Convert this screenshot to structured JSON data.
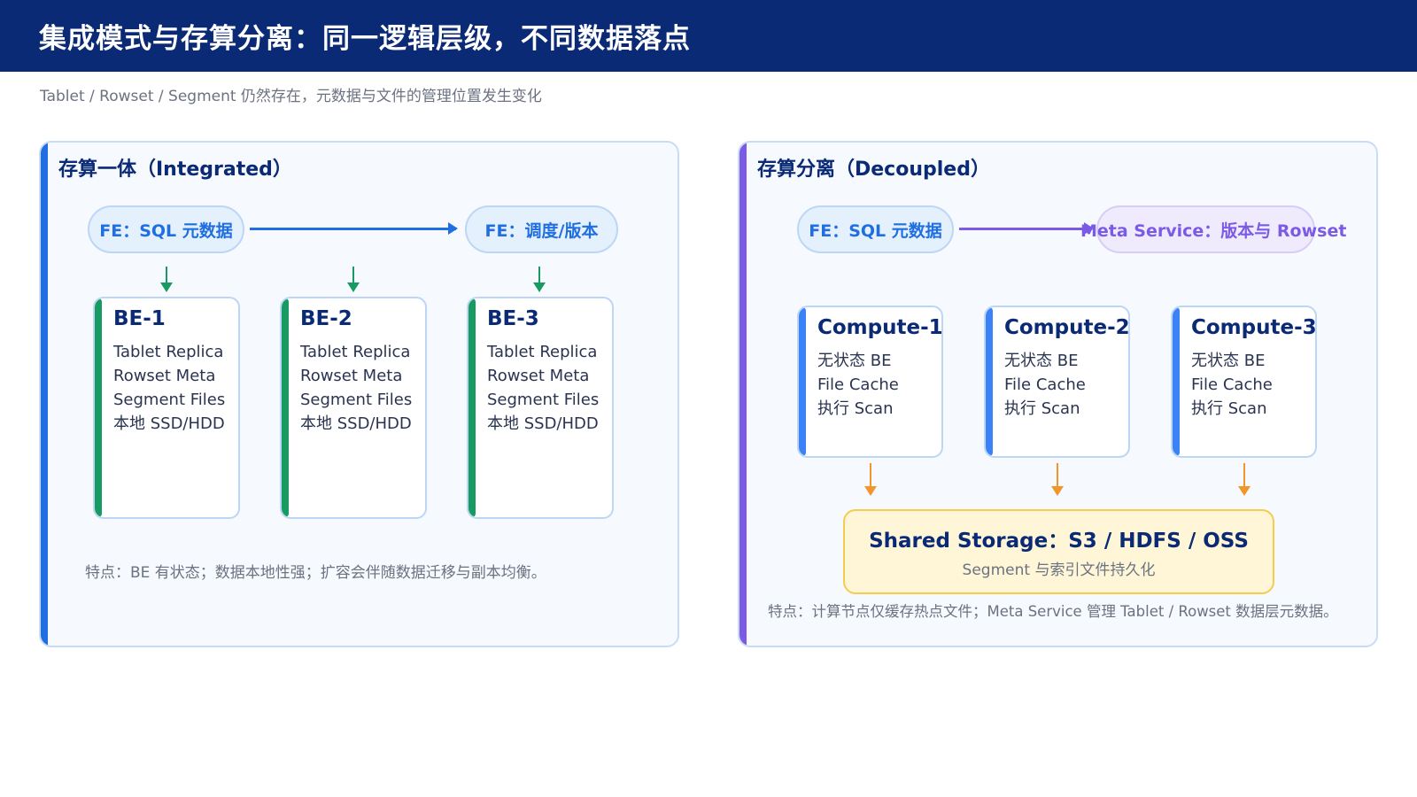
{
  "header": {
    "title": "集成模式与存算分离：同一逻辑层级，不同数据落点"
  },
  "subtitle": "Tablet / Rowset / Segment 仍然存在，元数据与文件的管理位置发生变化",
  "integrated": {
    "title": "存算一体（Integrated）",
    "fe_sql": "FE：SQL 元数据",
    "fe_schedule": "FE：调度/版本",
    "nodes": [
      {
        "name": "BE-1",
        "lines": [
          "Tablet Replica",
          "Rowset Meta",
          "Segment Files",
          "本地 SSD/HDD"
        ]
      },
      {
        "name": "BE-2",
        "lines": [
          "Tablet Replica",
          "Rowset Meta",
          "Segment Files",
          "本地 SSD/HDD"
        ]
      },
      {
        "name": "BE-3",
        "lines": [
          "Tablet Replica",
          "Rowset Meta",
          "Segment Files",
          "本地 SSD/HDD"
        ]
      }
    ],
    "note": "特点：BE 有状态；数据本地性强；扩容会伴随数据迁移与副本均衡。"
  },
  "decoupled": {
    "title": "存算分离（Decoupled）",
    "fe_sql": "FE：SQL 元数据",
    "meta_service": "Meta Service：版本与 Rowset",
    "nodes": [
      {
        "name": "Compute-1",
        "lines": [
          "无状态 BE",
          "File Cache",
          "执行 Scan"
        ]
      },
      {
        "name": "Compute-2",
        "lines": [
          "无状态 BE",
          "File Cache",
          "执行 Scan"
        ]
      },
      {
        "name": "Compute-3",
        "lines": [
          "无状态 BE",
          "File Cache",
          "执行 Scan"
        ]
      }
    ],
    "storage": {
      "title": "Shared Storage：S3 / HDFS / OSS",
      "subtitle": "Segment 与索引文件持久化"
    },
    "note": "特点：计算节点仅缓存热点文件；Meta Service 管理 Tablet / Rowset 数据层元数据。"
  },
  "colors": {
    "header_bg": "#0b2a75",
    "integrated_accent": "#1f6fe0",
    "decoupled_accent": "#7b5ae6",
    "be_accent": "#189a63",
    "compute_accent": "#3b82f6",
    "storage_border": "#f4cc4e",
    "storage_arrow": "#f0962a"
  }
}
